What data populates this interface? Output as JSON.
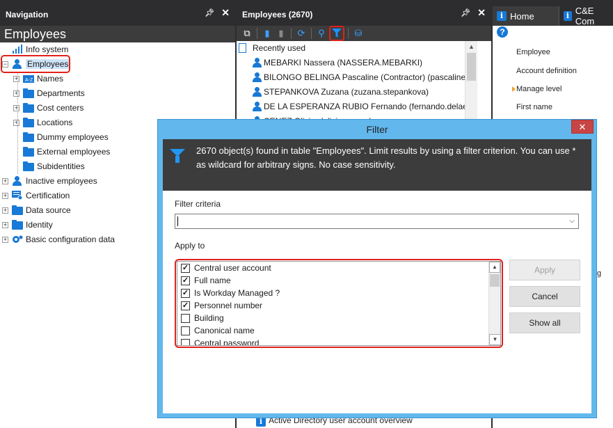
{
  "navigation": {
    "header": "Navigation",
    "title": "Employees",
    "tree": [
      {
        "label": "Info system",
        "level": 0,
        "icon": "chart-icon"
      },
      {
        "label": "Employees",
        "level": 0,
        "icon": "person-icon",
        "selected": true
      },
      {
        "label": "Names",
        "level": 1,
        "icon": "name-badge-icon"
      },
      {
        "label": "Departments",
        "level": 1,
        "icon": "folder-icon"
      },
      {
        "label": "Cost centers",
        "level": 1,
        "icon": "folder-icon"
      },
      {
        "label": "Locations",
        "level": 1,
        "icon": "folder-icon"
      },
      {
        "label": "Dummy employees",
        "level": 1,
        "icon": "folder-icon"
      },
      {
        "label": "External employees",
        "level": 1,
        "icon": "folder-icon"
      },
      {
        "label": "Subidentities",
        "level": 1,
        "icon": "folder-icon"
      },
      {
        "label": "Inactive employees",
        "level": 0,
        "icon": "person-icon"
      },
      {
        "label": "Certification",
        "level": 0,
        "icon": "certificate-icon"
      },
      {
        "label": "Data source",
        "level": 0,
        "icon": "folder-icon"
      },
      {
        "label": "Identity",
        "level": 0,
        "icon": "folder-icon"
      },
      {
        "label": "Basic configuration data",
        "level": 0,
        "icon": "config-gear-icon"
      }
    ]
  },
  "employees": {
    "header": "Employees (2670)",
    "recently_used": "Recently used",
    "rows": [
      "MEBARKI Nassera (NASSERA.MEBARKI)",
      "BILONGO BELINGA Pascaline (Contractor) (pascaline.bilon",
      "STEPANKOVA Zuzana (zuzana.stepankova)",
      "DE LA ESPERANZA RUBIO Fernando (fernando.delaesperar",
      "CENEZ Olivier (olivier.cenez)"
    ],
    "bottom_item": "Active Directory user account overview"
  },
  "right": {
    "tabs": [
      "Home",
      "C&E Com"
    ],
    "tasks": [
      "Employee",
      "Account definition",
      "Manage level",
      "First name"
    ],
    "clipped_char": "g"
  },
  "filter_dialog": {
    "title": "Filter",
    "close": "✕",
    "message": "2670 object(s) found in table \"Employees\". Limit results by using a filter criterion. You can use * as wildcard for arbitrary signs. No case sensitivity.",
    "criteria_label": "Filter criteria",
    "criteria_value": "",
    "apply_to_label": "Apply to",
    "fields": [
      {
        "label": "Central user account",
        "checked": true
      },
      {
        "label": "Full name",
        "checked": true
      },
      {
        "label": "Is Workday Managed ?",
        "checked": true
      },
      {
        "label": "Personnel number",
        "checked": true
      },
      {
        "label": "Building",
        "checked": false
      },
      {
        "label": "Canonical name",
        "checked": false
      },
      {
        "label": "Central password",
        "checked": false
      }
    ],
    "buttons": {
      "apply": "Apply",
      "cancel": "Cancel",
      "show_all": "Show all"
    }
  },
  "colors": {
    "accent": "#1879d6",
    "highlight": "#e0221c",
    "dialog_frame": "#62b8ec",
    "dark": "#2d2d30"
  }
}
